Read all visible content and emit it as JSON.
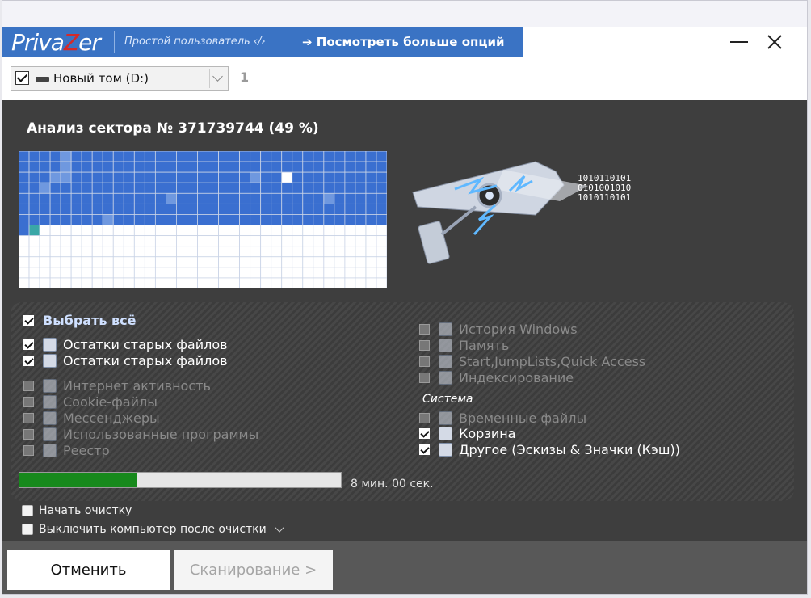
{
  "brand": {
    "logo_pre": "Priva",
    "logo_z": "Z",
    "logo_post": "er",
    "profile": "Простой пользователь ‹/›",
    "more_options": "➔ Посмотреть больше опций"
  },
  "drive": {
    "label": "Новый том (D:)",
    "checked": true,
    "count": "1"
  },
  "analysis": {
    "title": "Анализ сектора № 371739744 (49 %)",
    "binary_lines": [
      "1010110101",
      "0101001010",
      "1010110101"
    ]
  },
  "sector_grid": {
    "cols": 35,
    "rows": 13,
    "filled_rows": 7,
    "colors": {
      "filled": "#3a6fd0",
      "light": "#6f98df",
      "empty": "#ffffff",
      "teal": "#3aa7a7",
      "gridline": "#c9d3e6"
    }
  },
  "options": {
    "select_all": "Выбрать всё",
    "left": [
      {
        "label": "Остатки старых файлов",
        "checked": true,
        "enabled": true,
        "icon": "list-red-icon"
      },
      {
        "label": "Остатки старых файлов",
        "checked": true,
        "enabled": true,
        "icon": "grid-red-icon"
      },
      {
        "label": "Интернет активность",
        "checked": false,
        "enabled": false,
        "icon": "globe-icon"
      },
      {
        "label": "Cookie-файлы",
        "checked": false,
        "enabled": false,
        "icon": "cookie-icon"
      },
      {
        "label": "Мессенджеры",
        "checked": false,
        "enabled": false,
        "icon": "chat-bubble-icon"
      },
      {
        "label": "Использованные программы",
        "checked": false,
        "enabled": false,
        "icon": "app-window-icon"
      },
      {
        "label": "Реестр",
        "checked": false,
        "enabled": false,
        "icon": "registry-icon"
      }
    ],
    "right": [
      {
        "label": "История Windows",
        "checked": false,
        "enabled": false,
        "icon": "monitor-icon"
      },
      {
        "label": "Память",
        "checked": false,
        "enabled": false,
        "icon": "memory-icon"
      },
      {
        "label": "Start,JumpLists,Quick Access",
        "checked": false,
        "enabled": false,
        "icon": "stack-icon"
      },
      {
        "label": "Индексирование",
        "checked": false,
        "enabled": false,
        "icon": "index-list-icon"
      }
    ],
    "system_heading": "Система",
    "system": [
      {
        "label": "Временные файлы",
        "checked": false,
        "enabled": false,
        "icon": "document-icon"
      },
      {
        "label": "Корзина",
        "checked": true,
        "enabled": true,
        "icon": "recycle-bin-icon"
      },
      {
        "label": "Другое (Эскизы & Значки (Кэш))",
        "checked": true,
        "enabled": true,
        "icon": "thumbnails-icon"
      }
    ]
  },
  "progress": {
    "fraction": 0.365,
    "time": "8 мин. 00 сек.",
    "color": "#17891c"
  },
  "bottom_options": {
    "start_cleanup": "Начать очистку",
    "shutdown": "Выключить компьютер после очистки"
  },
  "buttons": {
    "cancel": "Отменить",
    "scan": "Сканирование >"
  }
}
